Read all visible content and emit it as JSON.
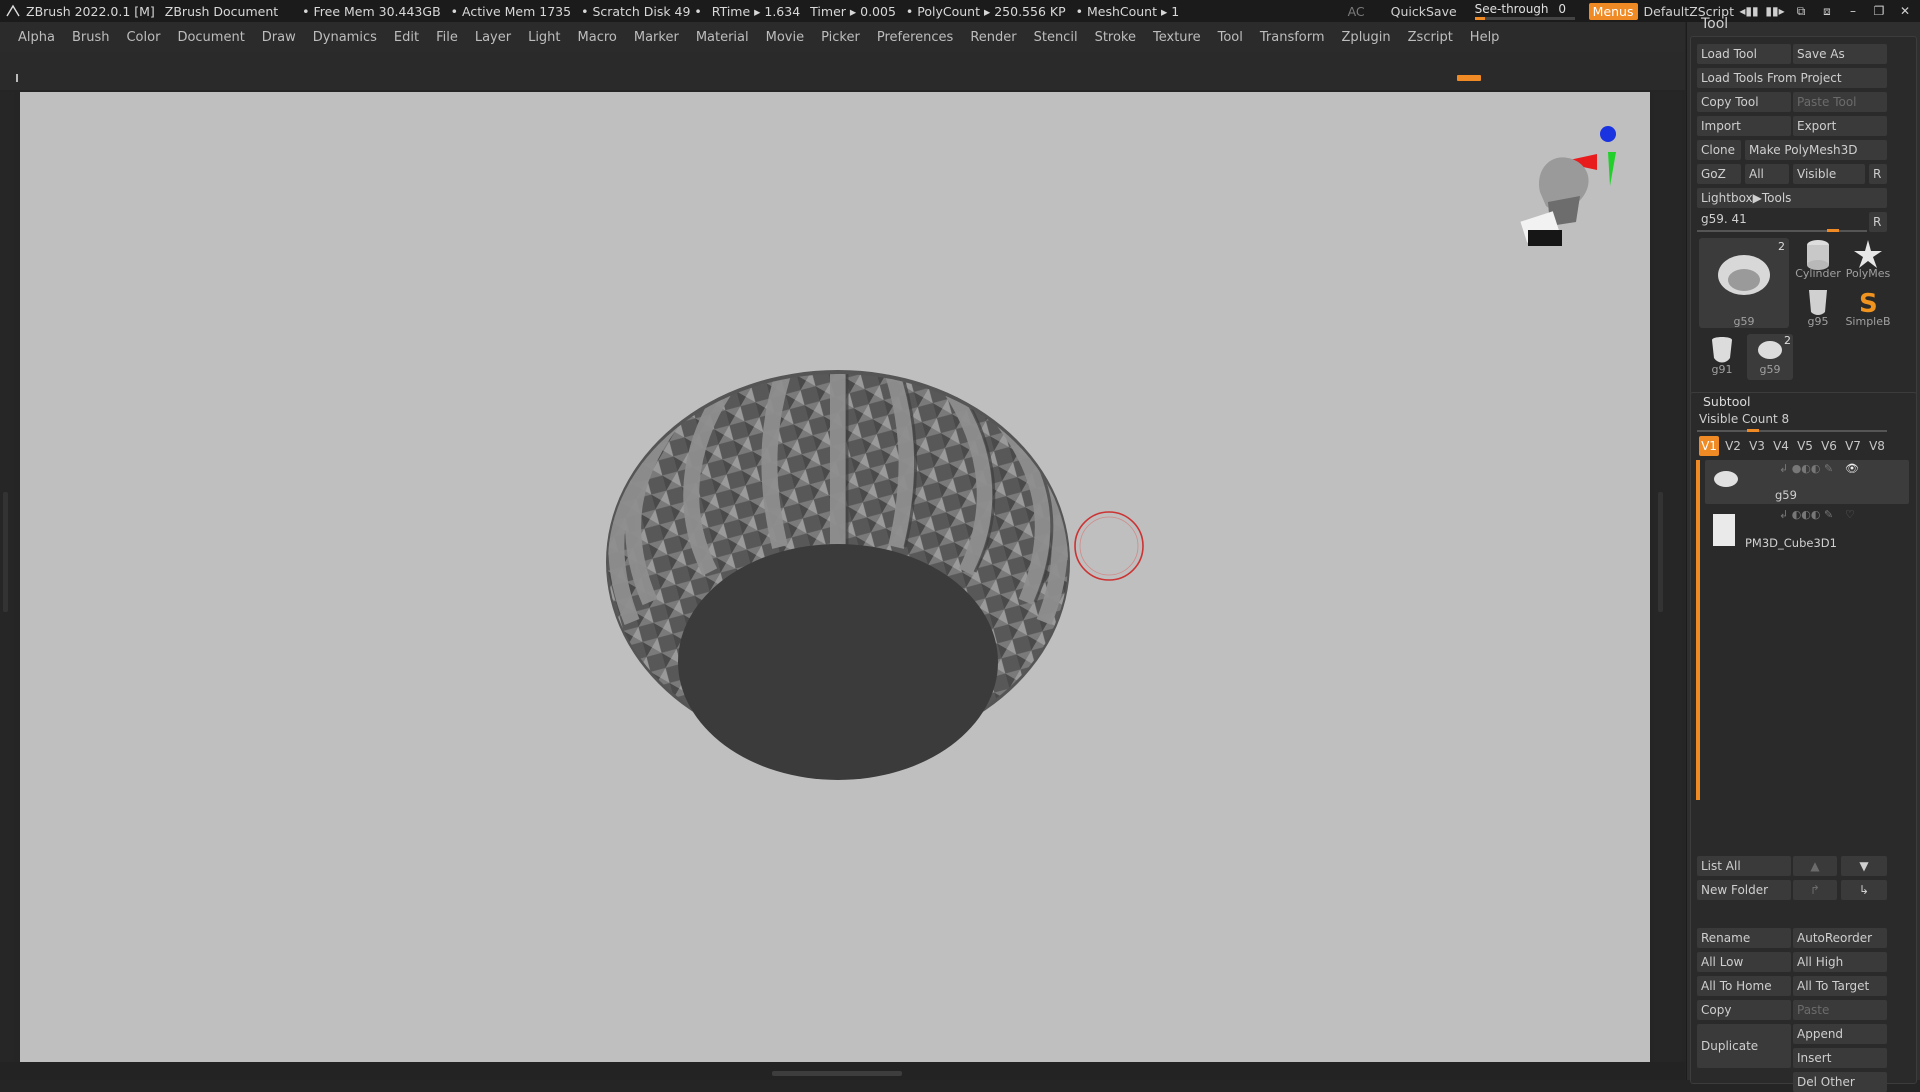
{
  "titlebar": {
    "app": "ZBrush 2022.0.1 [M]",
    "document": "ZBrush Document",
    "free_mem": "• Free Mem 30.443GB",
    "active_mem": "• Active Mem 1735",
    "scratch_disk": "• Scratch Disk 49 •",
    "rtime": "RTime ▸ 1.634",
    "timer": "Timer ▸ 0.005",
    "polycount": "• PolyCount ▸ 250.556 KP",
    "meshcount": "• MeshCount ▸ 1",
    "ac": "AC",
    "quicksave": "QuickSave",
    "see_through_label": "See-through",
    "see_through_value": "0",
    "see_through_level": 0.0,
    "menus": "Menus",
    "script": "DefaultZScript"
  },
  "menubar": {
    "items": [
      "Alpha",
      "Brush",
      "Color",
      "Document",
      "Draw",
      "Dynamics",
      "Edit",
      "File",
      "Layer",
      "Light",
      "Macro",
      "Marker",
      "Material",
      "Movie",
      "Picker",
      "Preferences",
      "Render",
      "Stencil",
      "Stroke",
      "Texture",
      "Tool",
      "Transform",
      "Zplugin",
      "Zscript",
      "Help"
    ]
  },
  "tool_panel": {
    "title": "Tool",
    "load_tool": "Load Tool",
    "save_as": "Save As",
    "load_tools_from_project": "Load Tools From Project",
    "copy_tool": "Copy Tool",
    "paste_tool": "Paste Tool",
    "import": "Import",
    "export": "Export",
    "clone": "Clone",
    "make_polymesh": "Make PolyMesh3D",
    "goz": "GoZ",
    "all": "All",
    "visible": "Visible",
    "r": "R",
    "lightbox_tools": "Lightbox▶Tools",
    "current_tool_label": "g59. 41",
    "current_tool_r": "R",
    "thumbs": {
      "main_name": "g59",
      "main_count": "2",
      "cylinder": "Cylinder",
      "polymesh": "PolyMes",
      "g95": "g95",
      "simpleb": "SimpleB",
      "g91": "g91",
      "g59b": "g59",
      "g59b_count": "2"
    }
  },
  "subtool": {
    "title": "Subtool",
    "visible_count_label": "Visible Count",
    "visible_count": "8",
    "versions": [
      "V1",
      "V2",
      "V3",
      "V4",
      "V5",
      "V6",
      "V7",
      "V8"
    ],
    "items": [
      {
        "name": "g59"
      },
      {
        "name": "PM3D_Cube3D1"
      }
    ],
    "list_all": "List All",
    "new_folder": "New Folder",
    "rename": "Rename",
    "autoreorder": "AutoReorder",
    "all_low": "All Low",
    "all_high": "All High",
    "all_to_home": "All To Home",
    "all_to_target": "All To Target",
    "copy": "Copy",
    "paste": "Paste",
    "duplicate": "Duplicate",
    "append": "Append",
    "insert": "Insert",
    "del_other": "Del Other"
  },
  "colors": {
    "accent": "#f08a24",
    "canvas": "#bfbfbf",
    "panel": "#2f2f2f"
  }
}
